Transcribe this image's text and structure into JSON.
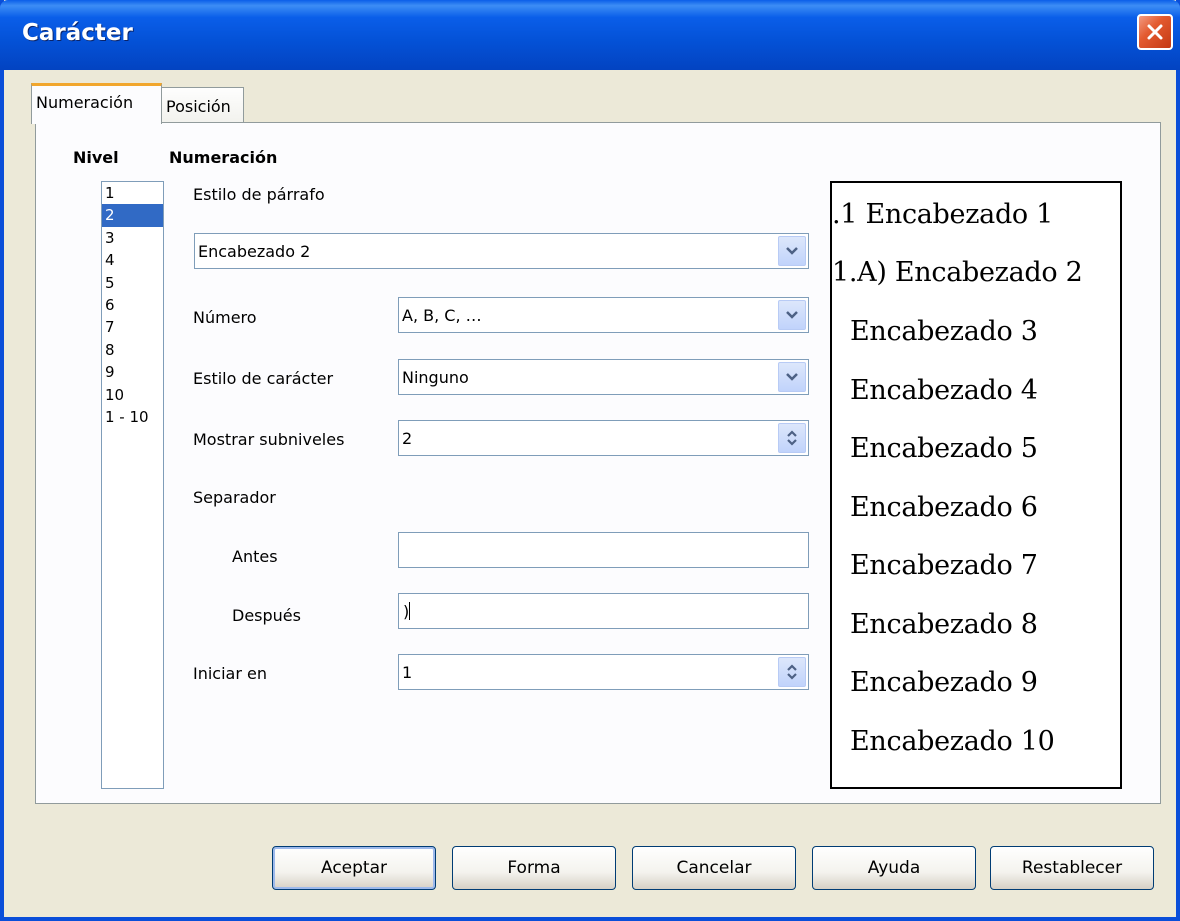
{
  "window": {
    "title": "Carácter"
  },
  "tabs": [
    {
      "label": "Numeración",
      "active": true
    },
    {
      "label": "Posición",
      "active": false
    }
  ],
  "level": {
    "heading": "Nivel",
    "items": [
      "1",
      "2",
      "3",
      "4",
      "5",
      "6",
      "7",
      "8",
      "9",
      "10",
      "1 - 10"
    ],
    "selected": "2"
  },
  "numbering": {
    "heading": "Numeración",
    "paragraph_style_label": "Estilo de párrafo",
    "paragraph_style_value": "Encabezado 2",
    "number_label": "Número",
    "number_value": "A, B, C, …",
    "char_style_label": "Estilo de carácter",
    "char_style_value": "Ninguno",
    "show_sublevels_label": "Mostrar subniveles",
    "show_sublevels_value": "2",
    "separator_label": "Separador",
    "before_label": "Antes",
    "before_value": "",
    "after_label": "Después",
    "after_value": ")",
    "start_at_label": "Iniciar en",
    "start_at_value": "1"
  },
  "preview": [
    ".1 Encabezado 1",
    "1.A) Encabezado 2",
    "Encabezado 3",
    "Encabezado 4",
    "Encabezado 5",
    "Encabezado 6",
    "Encabezado 7",
    "Encabezado 8",
    "Encabezado 9",
    "Encabezado 10"
  ],
  "buttons": {
    "ok": "Aceptar",
    "format": "Forma",
    "cancel": "Cancelar",
    "help": "Ayuda",
    "reset": "Restablecer"
  },
  "colors": {
    "titlebar": "#0451d6",
    "selection": "#316ac5",
    "active_tab_accent": "#f1a62d",
    "close_button": "#e35a2f"
  }
}
